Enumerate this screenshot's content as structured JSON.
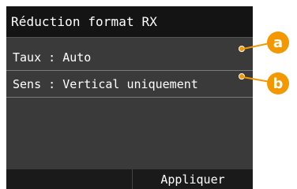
{
  "header": {
    "title": "Réduction format RX"
  },
  "settings": {
    "items": [
      {
        "label": "Taux : Auto"
      },
      {
        "label": "Sens : Vertical uniquement"
      }
    ]
  },
  "footer": {
    "apply_label": "Appliquer"
  },
  "callouts": [
    {
      "letter": "a"
    },
    {
      "letter": "b"
    }
  ],
  "colors": {
    "accent": "#f39800",
    "panel": "#3a3a3a",
    "titlebar": "#141414"
  }
}
